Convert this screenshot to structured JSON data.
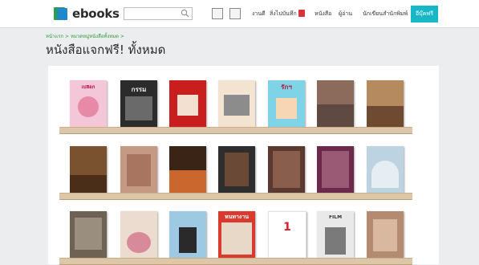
{
  "header": {
    "logo_text": "ebooks",
    "logo_icon": "book-logo-icon",
    "search_placeholder": "",
    "nav": [
      "งานดี",
      "สิ่งไปบันทึก",
      "หนังสือ",
      "ผู้อ่าน",
      "นักเขียนสำนักพิมพ์"
    ],
    "cta_label": "อีบุ๊คฟรี",
    "accent": "#18b7c6"
  },
  "breadcrumb": "หน้าแรก > หมวดหมู่หนังสือทั้งหมด >",
  "page_title": "หนังสือแจกฟรี! ทั้งหมด",
  "shelves": [
    {
      "books": [
        {
          "title": "เปลือก",
          "bg": "#f4c7d8",
          "fg": "#b0123c"
        },
        {
          "title": "กรรม",
          "bg": "#2b2b2b",
          "fg": "#e8e8e8"
        },
        {
          "title": "",
          "bg": "#c81e1e",
          "fg": "#ffffff"
        },
        {
          "title": "",
          "bg": "#f3e4d2",
          "fg": "#7a4a2a"
        },
        {
          "title": "รักฯ",
          "bg": "#7fd3e6",
          "fg": "#c0143c"
        },
        {
          "title": "",
          "bg": "#8c6a5c",
          "fg": "#ffffff"
        },
        {
          "title": "",
          "bg": "#b58a5e",
          "fg": "#ffffff"
        }
      ]
    },
    {
      "books": [
        {
          "title": "",
          "bg": "#7a5230",
          "fg": "#ffffff"
        },
        {
          "title": "",
          "bg": "#c49a84",
          "fg": "#ffffff"
        },
        {
          "title": "",
          "bg": "#3a2416",
          "fg": "#f1c27d"
        },
        {
          "title": "",
          "bg": "#2e2e2e",
          "fg": "#d9a066"
        },
        {
          "title": "",
          "bg": "#5a3a30",
          "fg": "#ffffff"
        },
        {
          "title": "",
          "bg": "#6b2a4a",
          "fg": "#ffffff"
        },
        {
          "title": "",
          "bg": "#bcd4e2",
          "fg": "#2a5a8a"
        }
      ]
    },
    {
      "books": [
        {
          "title": "",
          "bg": "#6e6254",
          "fg": "#ffffff"
        },
        {
          "title": "",
          "bg": "#ecdcd0",
          "fg": "#c0143c"
        },
        {
          "title": "",
          "bg": "#9ec9e3",
          "fg": "#c0143c"
        },
        {
          "title": "หนทางาน",
          "bg": "#d83a2e",
          "fg": "#ffffff"
        },
        {
          "title": "1",
          "bg": "#ffffff",
          "fg": "#d8202a"
        },
        {
          "title": "FILM",
          "bg": "#e9e9e9",
          "fg": "#333333"
        },
        {
          "title": "",
          "bg": "#b48a70",
          "fg": "#ffffff"
        }
      ]
    }
  ]
}
